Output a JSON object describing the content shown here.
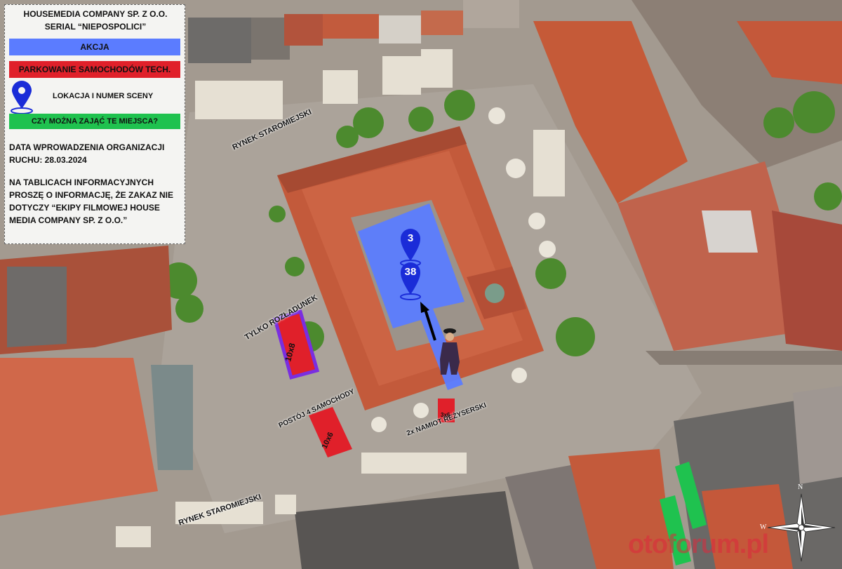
{
  "legend": {
    "company": "HOUSEMEDIA COMPANY SP. Z O.O.",
    "series": "SERIAL “NIEPOSPOLICI”",
    "akcja_label": "AKCJA",
    "parking_label": "PARKOWANIE SAMOCHODÓW TECH.",
    "location_label": "LOKACJA I NUMER SCENY",
    "question_label": "CZY MOŻNA ZAJĄĆ TE MIEJSCA?",
    "date_line1": "DATA WPROWADZENIA ORGANIZACJI",
    "date_line2": "RUCHU: 28.03.2024",
    "note_line1": "NA TABLICACH INFORMACYJNYCH",
    "note_line2": "PROSZĘ O INFORMACJĘ, ŻE ZAKAZ NIE",
    "note_line3": "DOTYCZY “EKIPY FILMOWEJ HOUSE",
    "note_line4": "MEDIA COMPANY SP. Z O.O.”",
    "colors": {
      "akcja": "#5b7cff",
      "parking": "#e0202a",
      "question": "#1fc24f",
      "pin": "#1a2cd8"
    }
  },
  "map": {
    "street_label_1": "RYNEK STAROMIEJSKI",
    "street_label_2": "RYNEK STAROMIEJSKI",
    "unloading_label": "TYLKO ROZŁADUNEK",
    "unloading_size": "10x8",
    "parking_label": "POSTÓJ 4 SAMOCHODY",
    "parking_size": "10x6",
    "tent_label": "2x NAMIOT REŻYSERSKI",
    "tent_size": "3x6",
    "scene_numbers": [
      "3",
      "38"
    ],
    "watermark": "otoforum.pl",
    "compass_letters": [
      "N",
      "W"
    ]
  }
}
